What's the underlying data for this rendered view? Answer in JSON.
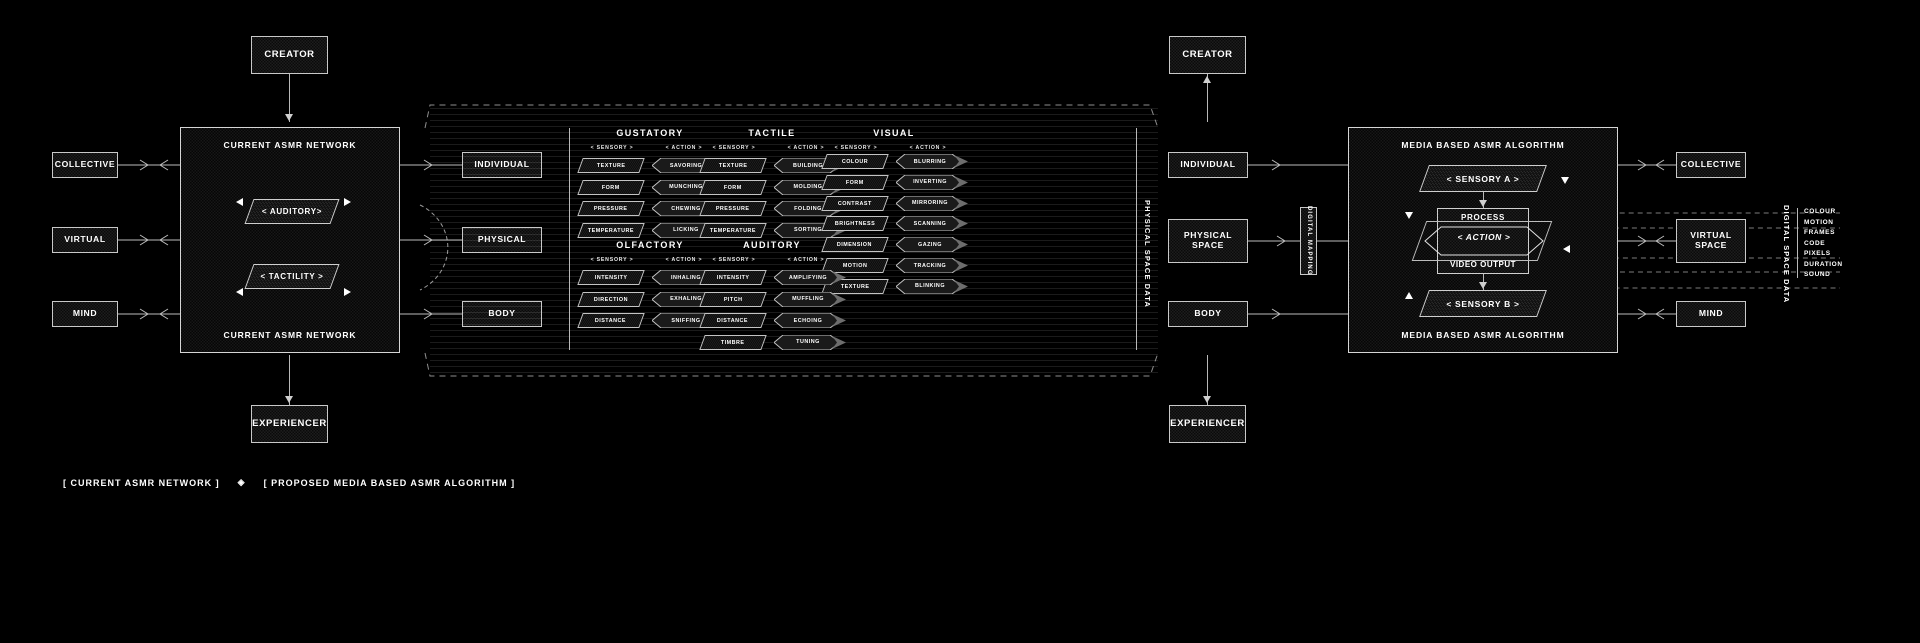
{
  "diagram": {
    "left_panel": {
      "title_top": "CURRENT ASMR NETWORK",
      "title_bottom": "CURRENT ASMR NETWORK"
    },
    "right_panel": {
      "title_top": "MEDIA BASED ASMR ALGORITHM",
      "title_bottom": "MEDIA BASED ASMR ALGORITHM"
    },
    "top_nodes": {
      "left": "CREATOR",
      "right": "CREATOR"
    },
    "bottom_nodes": {
      "left": "EXPERIENCER",
      "right": "EXPERIENCER"
    },
    "far_left_nodes": [
      "COLLECTIVE",
      "VIRTUAL",
      "MIND"
    ],
    "far_right_nodes": [
      "COLLECTIVE",
      "VIRTUAL SPACE",
      "MIND"
    ],
    "inner_left_nodes": [
      "INDIVIDUAL",
      "PHYSICAL",
      "BODY"
    ],
    "inner_right_nodes": [
      "INDIVIDUAL",
      "PHYSICAL SPACE",
      "BODY"
    ],
    "left_parallelograms": [
      "< AUDITORY>",
      "< TACTILITY >"
    ],
    "right_parallelograms": [
      "< SENSORY A >",
      "< SENSORY B >"
    ],
    "process_box": {
      "title": "PROCESS",
      "action": "< ACTION >",
      "output": "VIDEO OUTPUT"
    },
    "vertical_labels": {
      "physical_space_data": "PHYSICAL SPACE DATA",
      "digital_mapping": "DIGITAL MAPPING",
      "digital_space_data": "DIGITAL SPACE DATA"
    },
    "digital_space_data_items": [
      "COLOUR",
      "MOTION",
      "FRAMES",
      "CODE",
      "PIXELS",
      "DURATION",
      "SOUND"
    ],
    "sub_headers": {
      "sensory": "< SENSORY >",
      "action": "< ACTION >"
    },
    "modality_groups": [
      {
        "name": "GUSTATORY",
        "sensory": [
          "TEXTURE",
          "FORM",
          "PRESSURE",
          "TEMPERATURE"
        ],
        "action": [
          "SAVORING",
          "MUNCHING",
          "CHEWING",
          "LICKING"
        ]
      },
      {
        "name": "TACTILE",
        "sensory": [
          "TEXTURE",
          "FORM",
          "PRESSURE",
          "TEMPERATURE"
        ],
        "action": [
          "BUILDING",
          "MOLDING",
          "FOLDING",
          "SORTING"
        ]
      },
      {
        "name": "VISUAL",
        "sensory": [
          "COLOUR",
          "FORM",
          "CONTRAST",
          "BRIGHTNESS",
          "DIMENSION",
          "MOTION",
          "TEXTURE"
        ],
        "action": [
          "BLURRING",
          "INVERTING",
          "MIRRORING",
          "SCANNING",
          "GAZING",
          "TRACKING",
          "BLINKING"
        ]
      },
      {
        "name": "OLFACTORY",
        "sensory": [
          "INTENSITY",
          "DIRECTION",
          "DISTANCE"
        ],
        "action": [
          "INHALING",
          "EXHALING",
          "SNIFFING"
        ]
      },
      {
        "name": "AUDITORY",
        "sensory": [
          "INTENSITY",
          "PITCH",
          "DISTANCE",
          "TIMBRE"
        ],
        "action": [
          "AMPLIFYING",
          "MUFFLING",
          "ECHOING",
          "TUNING"
        ]
      }
    ],
    "legend": {
      "left": "[ CURRENT ASMR NETWORK ]",
      "separator": "◈",
      "right": "[ PROPOSED MEDIA BASED ASMR ALGORITHM ]"
    },
    "colors": {
      "background": "#000000",
      "stroke": "#c9c9c9",
      "text": "#ffffff"
    }
  }
}
